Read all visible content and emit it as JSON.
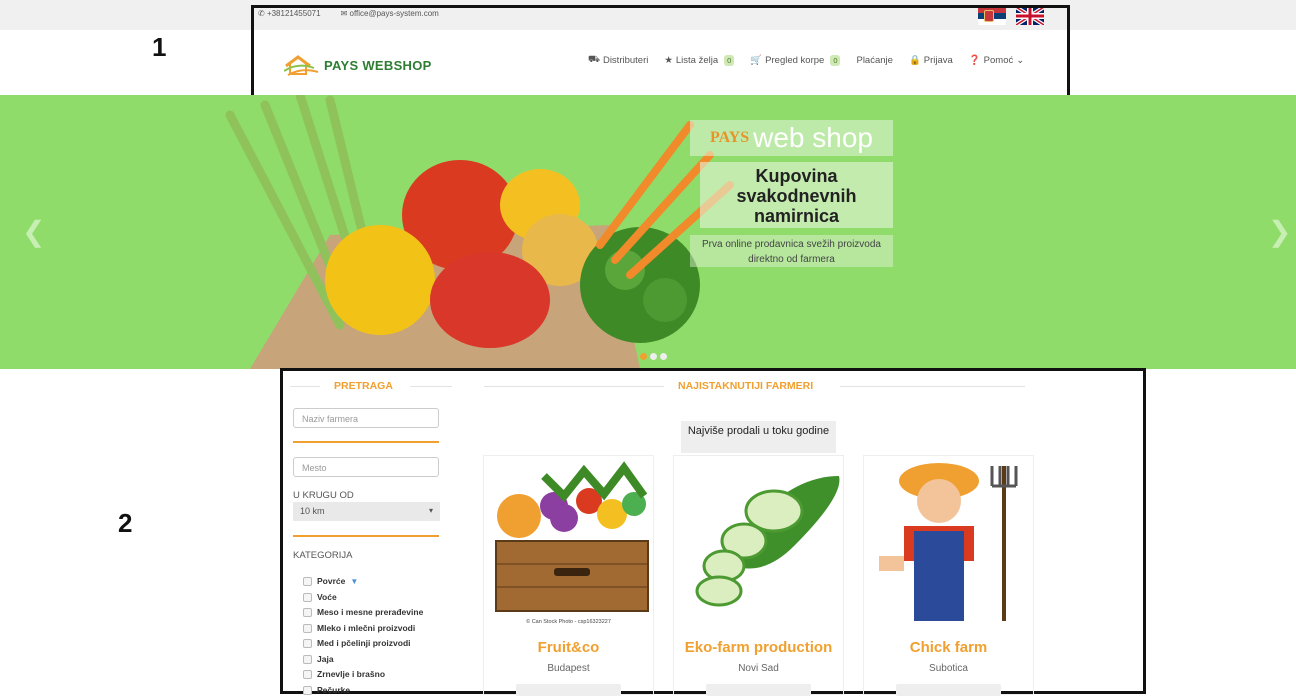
{
  "topbar": {
    "phone": "+38121455071",
    "email": "office@pays-system.com"
  },
  "header": {
    "logo_text": "PAYS WEBSHOP",
    "nav": {
      "distributors": "Distributeri",
      "wishlist": "Lista želja",
      "wishlist_count": "0",
      "cart": "Pregled korpe",
      "cart_count": "0",
      "payment": "Plaćanje",
      "login": "Prijava",
      "help": "Pomoć"
    }
  },
  "annotations": {
    "one": "1",
    "two": "2"
  },
  "hero": {
    "brand_pays": "PAYS",
    "brand_rest": "web shop",
    "headline": "Kupovina svakodnevnih namirnica",
    "description": "Prva online prodavnica svežih proizvoda direktno od farmera",
    "slides": 3,
    "active_slide": 1
  },
  "search": {
    "title": "PRETRAGA",
    "farmer_placeholder": "Naziv farmera",
    "place_placeholder": "Mesto",
    "radius_label": "U KRUGU OD",
    "radius_value": "10 km",
    "category_label": "KATEGORIJA",
    "categories": [
      "Povrće",
      "Voće",
      "Meso i mesne prerađevine",
      "Mleko i mlečni proizvodi",
      "Med i pčelinji proizvodi",
      "Jaja",
      "Zrnevlje i brašno",
      "Pečurke"
    ]
  },
  "farmers": {
    "title": "NAJISTAKNUTIJI FARMERI",
    "tooltip": "Najviše prodali u toku godine",
    "cards": [
      {
        "name": "Fruit&co",
        "city": "Budapest",
        "caption": "© Can Stock Photo - csp16323227"
      },
      {
        "name": "Eko-farm production",
        "city": "Novi Sad"
      },
      {
        "name": "Chick farm",
        "city": "Subotica"
      }
    ]
  },
  "colors": {
    "accent": "#f0a030",
    "hero": "#8fdc6a",
    "brand": "#2e7d32"
  }
}
